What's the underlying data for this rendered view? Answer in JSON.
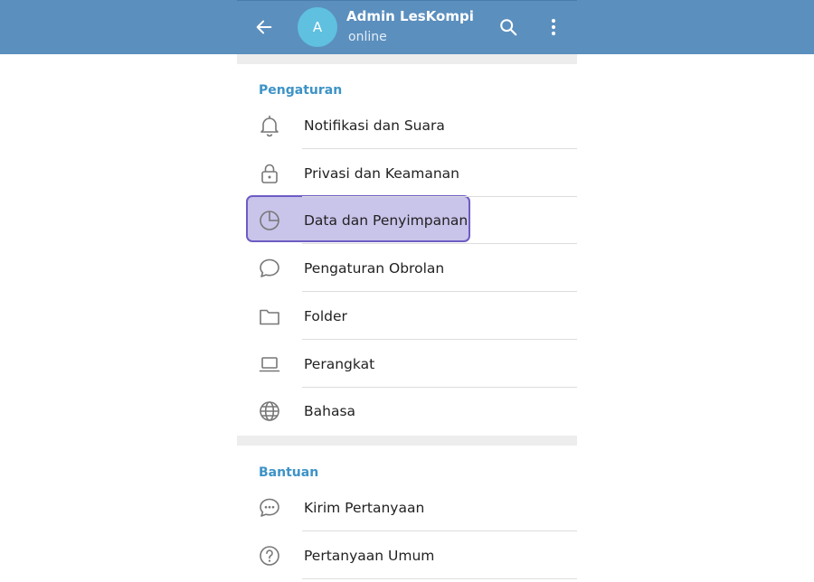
{
  "header": {
    "avatar_initial": "A",
    "name": "Admin LesKompi",
    "status": "online"
  },
  "sections": {
    "settings": {
      "title": "Pengaturan",
      "items": [
        {
          "label": "Notifikasi dan Suara",
          "icon": "bell-icon"
        },
        {
          "label": "Privasi dan Keamanan",
          "icon": "lock-icon"
        },
        {
          "label": "Data dan Penyimpanan",
          "icon": "pie-chart-icon",
          "highlighted": true
        },
        {
          "label": "Pengaturan Obrolan",
          "icon": "chat-bubble-icon"
        },
        {
          "label": "Folder",
          "icon": "folder-icon"
        },
        {
          "label": "Perangkat",
          "icon": "laptop-icon"
        },
        {
          "label": "Bahasa",
          "icon": "globe-icon"
        }
      ]
    },
    "help": {
      "title": "Bantuan",
      "items": [
        {
          "label": "Kirim Pertanyaan",
          "icon": "chat-dots-icon"
        },
        {
          "label": "Pertanyaan Umum",
          "icon": "question-circle-icon"
        }
      ]
    }
  },
  "colors": {
    "header": "#5b8fbe",
    "accent": "#3d93c6",
    "highlight_fill": "#c9c4ea",
    "highlight_border": "#6d5cc4"
  }
}
